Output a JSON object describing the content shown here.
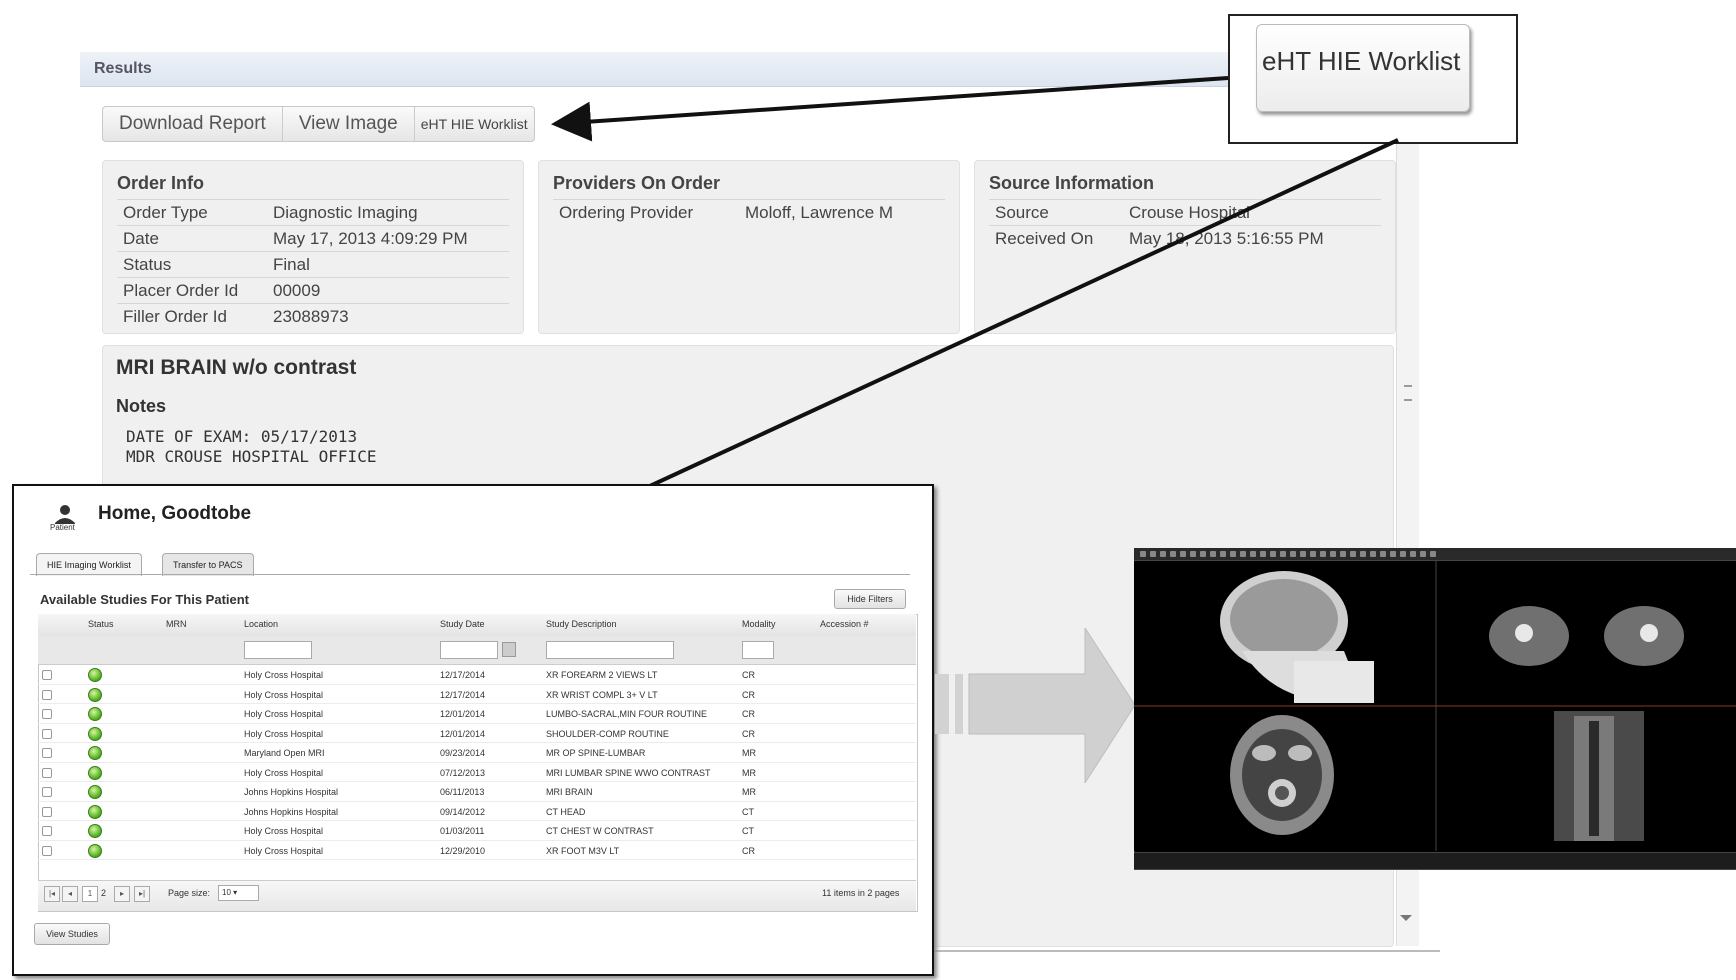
{
  "results": {
    "title": "Results",
    "buttons": {
      "download": "Download Report",
      "view_image": "View Image",
      "worklist": "eHT HIE Worklist"
    },
    "order_info": {
      "heading": "Order Info",
      "rows": [
        {
          "label": "Order Type",
          "value": "Diagnostic Imaging"
        },
        {
          "label": "Date",
          "value": "May 17, 2013 4:09:29 PM"
        },
        {
          "label": "Status",
          "value": "Final"
        },
        {
          "label": "Placer Order Id",
          "value": "00009"
        },
        {
          "label": "Filler Order Id",
          "value": "23088973"
        }
      ]
    },
    "providers": {
      "heading": "Providers On Order",
      "rows": [
        {
          "label": "Ordering Provider",
          "value": "Moloff, Lawrence M"
        }
      ]
    },
    "source": {
      "heading": "Source Information",
      "rows": [
        {
          "label": "Source",
          "value": "Crouse Hospital"
        },
        {
          "label": "Received On",
          "value": "May 18, 2013 5:16:55 PM"
        }
      ]
    },
    "report": {
      "title": "MRI BRAIN w/o contrast",
      "notes_label": "Notes",
      "notes_lines": [
        "DATE OF EXAM: 05/17/2013",
        "MDR CROUSE HOSPITAL OFFICE"
      ]
    }
  },
  "callout": {
    "label": "eHT HIE Worklist"
  },
  "worklist": {
    "patient_icon_label": "Patient",
    "patient_name": "Home, Goodtobe",
    "tabs": [
      "HIE Imaging Worklist",
      "Transfer to PACS"
    ],
    "section_title": "Available Studies For This Patient",
    "hide_filters": "Hide Filters",
    "columns": [
      "Status",
      "MRN",
      "Location",
      "Study Date",
      "Study Description",
      "Modality",
      "Accession #"
    ],
    "rows": [
      {
        "location": "Holy Cross Hospital",
        "date": "12/17/2014",
        "description": "XR FOREARM 2 VIEWS LT",
        "modality": "CR"
      },
      {
        "location": "Holy Cross Hospital",
        "date": "12/17/2014",
        "description": "XR WRIST COMPL 3+ V LT",
        "modality": "CR"
      },
      {
        "location": "Holy Cross Hospital",
        "date": "12/01/2014",
        "description": "LUMBO-SACRAL,MIN FOUR ROUTINE",
        "modality": "CR"
      },
      {
        "location": "Holy Cross Hospital",
        "date": "12/01/2014",
        "description": "SHOULDER-COMP ROUTINE",
        "modality": "CR"
      },
      {
        "location": "Maryland Open MRI",
        "date": "09/23/2014",
        "description": "MR OP SPINE-LUMBAR",
        "modality": "MR"
      },
      {
        "location": "Holy Cross Hospital",
        "date": "07/12/2013",
        "description": "MRI LUMBAR SPINE WWO CONTRAST",
        "modality": "MR"
      },
      {
        "location": "Johns Hopkins Hospital",
        "date": "06/11/2013",
        "description": "MRI BRAIN",
        "modality": "MR"
      },
      {
        "location": "Johns Hopkins Hospital",
        "date": "09/14/2012",
        "description": "CT HEAD",
        "modality": "CT"
      },
      {
        "location": "Holy Cross Hospital",
        "date": "01/03/2011",
        "description": "CT CHEST W CONTRAST",
        "modality": "CT"
      },
      {
        "location": "Holy Cross Hospital",
        "date": "12/29/2010",
        "description": "XR FOOT M3V LT",
        "modality": "CR"
      }
    ],
    "pager": {
      "pages": [
        "1",
        "2"
      ],
      "page_size_label": "Page size:",
      "page_size": "10",
      "summary": "11 items in 2 pages"
    },
    "view_studies": "View Studies"
  },
  "colors": {
    "status_ok": "#5cb82c",
    "arrow_gray": "#cfcfcf",
    "panel_bg": "#f0f0f0"
  }
}
